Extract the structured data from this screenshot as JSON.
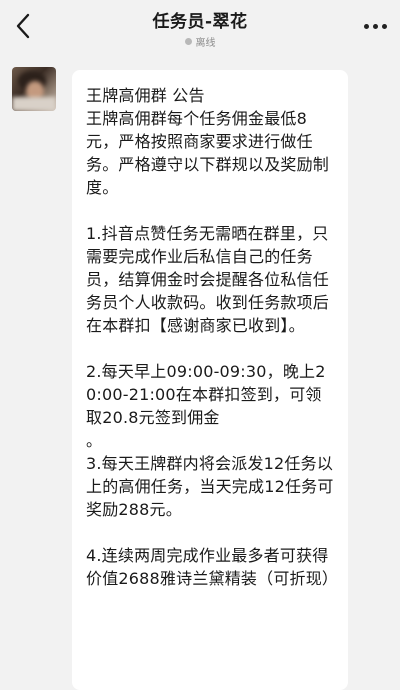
{
  "header": {
    "title": "任务员-翠花",
    "status": "离线",
    "back_icon": "chevron-left-icon",
    "more_icon": "more-dots-icon"
  },
  "message": {
    "line1": "王牌高佣群 公告",
    "para1": "王牌高佣群每个任务佣金最低8元，严格按照商家要求进行做任务。严格遵守以下群规以及奖励制度。",
    "para2": "1.抖音点赞任务无需晒在群里，只需要完成作业后私信自己的任务员，结算佣金时会提醒各位私信任务员个人收款码。收到任务款项后在本群扣【感谢商家已收到】。",
    "para3": "2.每天早上09:00-09:30，晚上20:00-21:00在本群扣签到，可领取20.8元签到佣金",
    "para3b": "。",
    "para4": "3.每天王牌群内将会派发12任务以上的高佣任务，当天完成12任务可奖励288元。",
    "para5": "4.连续两周完成作业最多者可获得价值2688雅诗兰黛精装（可折现）"
  }
}
